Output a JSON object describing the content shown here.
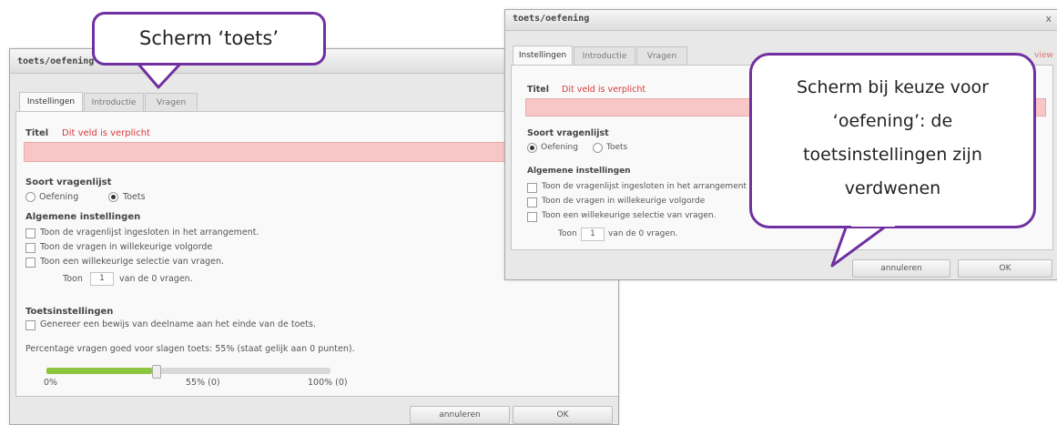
{
  "left_dialog": {
    "title": "toets/oefening",
    "tabs": [
      {
        "label": "Instellingen",
        "active": true
      },
      {
        "label": "Introductie",
        "active": false
      },
      {
        "label": "Vragen",
        "active": false
      }
    ],
    "titel_label": "Titel",
    "required_msg": "Dit veld is verplicht",
    "soort_label": "Soort vragenlijst",
    "radio_options": [
      {
        "label": "Oefening",
        "selected": false
      },
      {
        "label": "Toets",
        "selected": true
      }
    ],
    "algemene_label": "Algemene instellingen",
    "checkboxes": [
      {
        "label": "Toon de vragenlijst ingesloten in het arrangement.",
        "checked": false
      },
      {
        "label": "Toon de vragen in willekeurige volgorde",
        "checked": false
      },
      {
        "label": "Toon een willekeurige selectie van vragen.",
        "checked": false
      }
    ],
    "toon_prefix": "Toon",
    "toon_value": "1",
    "toon_suffix": "van de 0 vragen.",
    "toets_label": "Toetsinstellingen",
    "bewijs_label": "Genereer een bewijs van deelname aan het einde van de toets.",
    "percentage_text": "Percentage vragen goed voor slagen toets: 55% (staat gelijk aan 0 punten).",
    "slider": {
      "value_percent": 55,
      "min_label": "0%",
      "mid_label": "55% (0)",
      "max_label": "100% (0)"
    },
    "cancel_label": "annuleren",
    "ok_label": "OK"
  },
  "right_dialog": {
    "title": "toets/oefening",
    "close_label": "x",
    "tabs": [
      {
        "label": "Instellingen",
        "active": true
      },
      {
        "label": "Introductie",
        "active": false
      },
      {
        "label": "Vragen",
        "active": false
      }
    ],
    "preview_label": "view",
    "titel_label": "Titel",
    "required_msg": "Dit veld is verplicht",
    "soort_label": "Soort vragenlijst",
    "radio_options": [
      {
        "label": "Oefening",
        "selected": true
      },
      {
        "label": "Toets",
        "selected": false
      }
    ],
    "algemene_label": "Algemene instellingen",
    "checkboxes": [
      {
        "label": "Toon de vragenlijst ingesloten in het arrangement",
        "checked": false
      },
      {
        "label": "Toon de vragen in willekeurige volgorde",
        "checked": false
      },
      {
        "label": "Toon een willekeurige selectie van vragen.",
        "checked": false
      }
    ],
    "toon_prefix": "Toon",
    "toon_value": "1",
    "toon_suffix": "van de 0 vragen.",
    "cancel_label": "annuleren",
    "ok_label": "OK"
  },
  "callouts": {
    "left_text": "Scherm ‘toets’",
    "right_lines": [
      "Scherm bij keuze voor",
      "‘oefening’: de",
      "toetsinstellingen zijn",
      "verdwenen"
    ],
    "border_color": "#7030a0"
  }
}
